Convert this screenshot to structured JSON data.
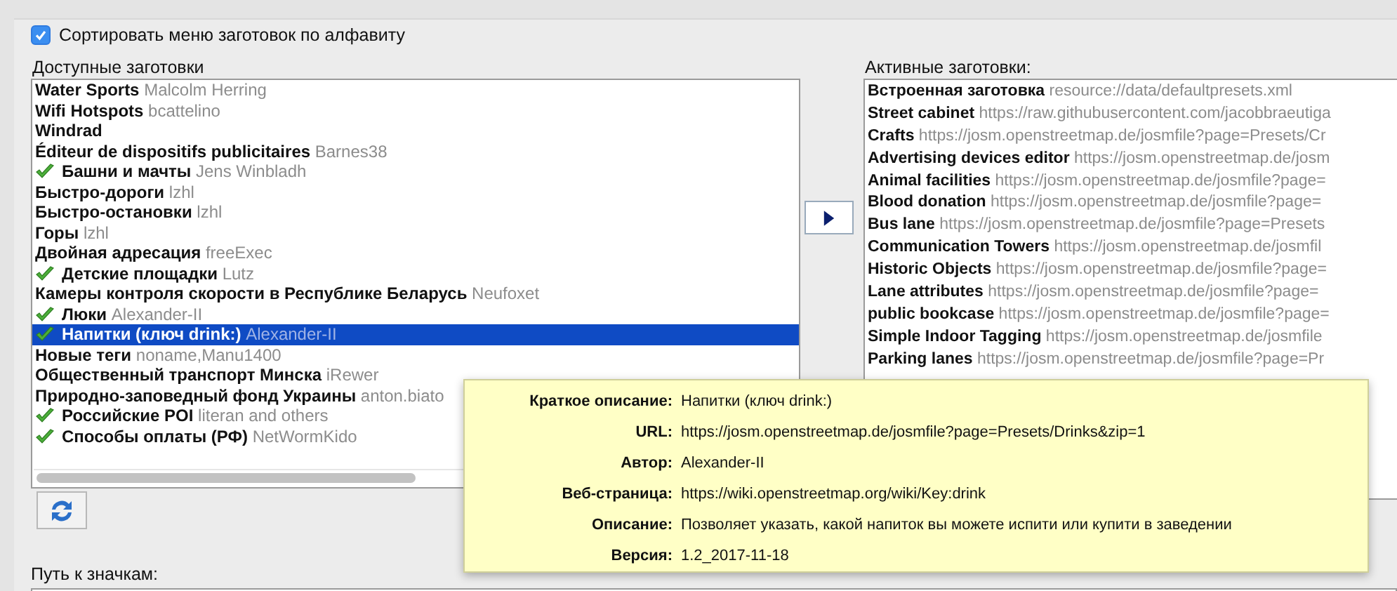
{
  "sort_alphabetically": {
    "label": "Сортировать меню заготовок по алфавиту",
    "checked": true
  },
  "available": {
    "label": "Доступные заготовки",
    "items": [
      {
        "name": "Water Sports",
        "author": "Malcolm Herring",
        "active": false,
        "selected": false
      },
      {
        "name": "Wifi Hotspots",
        "author": "bcattelino",
        "active": false,
        "selected": false
      },
      {
        "name": "Windrad",
        "active": false,
        "selected": false
      },
      {
        "name": "Éditeur de dispositifs publicitaires",
        "author": "Barnes38",
        "active": false,
        "selected": false
      },
      {
        "name": "Башни и мачты",
        "author": "Jens Winbladh",
        "active": true,
        "selected": false
      },
      {
        "name": "Быстро-дороги",
        "author": "lzhl",
        "active": false,
        "selected": false
      },
      {
        "name": "Быстро-остановки",
        "author": "lzhl",
        "active": false,
        "selected": false
      },
      {
        "name": "Горы",
        "author": "lzhl",
        "active": false,
        "selected": false
      },
      {
        "name": "Двойная адресация",
        "author": "freeExec",
        "active": false,
        "selected": false
      },
      {
        "name": "Детские площадки",
        "author": "Lutz",
        "active": true,
        "selected": false
      },
      {
        "name": "Камеры контроля скорости в Республике Беларусь",
        "author": "Neufoxet",
        "active": false,
        "selected": false
      },
      {
        "name": "Люки",
        "author": "Alexander-II",
        "active": true,
        "selected": false
      },
      {
        "name": "Напитки (ключ drink:)",
        "author": "Alexander-II",
        "active": true,
        "selected": true
      },
      {
        "name": "Новые теги",
        "author": "noname,Manu1400",
        "active": false,
        "selected": false
      },
      {
        "name": "Общественный транспорт Минска",
        "author": "iRewer",
        "active": false,
        "selected": false
      },
      {
        "name": "Природно-заповедный фонд Украины",
        "author": "anton.biato",
        "active": false,
        "selected": false
      },
      {
        "name": "Российские POI",
        "author": "literan and others",
        "active": true,
        "selected": false
      },
      {
        "name": "Способы оплаты (РФ)",
        "author": "NetWormKido",
        "active": true,
        "selected": false
      }
    ]
  },
  "active_presets": {
    "label": "Активные заготовки:",
    "items": [
      {
        "name": "Встроенная заготовка",
        "url": "resource://data/defaultpresets.xml"
      },
      {
        "name": "Street cabinet",
        "url": "https://raw.githubusercontent.com/jacobbraeutiga"
      },
      {
        "name": "Crafts",
        "url": "https://josm.openstreetmap.de/josmfile?page=Presets/Cr"
      },
      {
        "name": "Advertising devices editor",
        "url": "https://josm.openstreetmap.de/josm"
      },
      {
        "name": "Animal facilities",
        "url": "https://josm.openstreetmap.de/josmfile?page="
      },
      {
        "name": "Blood donation",
        "url": "https://josm.openstreetmap.de/josmfile?page="
      },
      {
        "name": "Bus lane",
        "url": "https://josm.openstreetmap.de/josmfile?page=Presets"
      },
      {
        "name": "Communication Towers",
        "url": "https://josm.openstreetmap.de/josmfil"
      },
      {
        "name": "Historic Objects",
        "url": "https://josm.openstreetmap.de/josmfile?page="
      },
      {
        "name": "Lane attributes",
        "url": "https://josm.openstreetmap.de/josmfile?page="
      },
      {
        "name": "public bookcase",
        "url": "https://josm.openstreetmap.de/josmfile?page="
      },
      {
        "name": "Simple Indoor Tagging",
        "url": "https://josm.openstreetmap.de/josmfile"
      },
      {
        "name": "Parking lanes",
        "url": "https://josm.openstreetmap.de/josmfile?page=Pr"
      }
    ]
  },
  "icon_path": {
    "label": "Путь к значкам:"
  },
  "tooltip": {
    "rows": [
      {
        "label": "Краткое описание:",
        "value": "Напитки (ключ drink:)"
      },
      {
        "label": "URL:",
        "value": "https://josm.openstreetmap.de/josmfile?page=Presets/Drinks&zip=1"
      },
      {
        "label": "Автор:",
        "value": "Alexander-II"
      },
      {
        "label": "Веб-страница:",
        "value": "https://wiki.openstreetmap.org/wiki/Key:drink"
      },
      {
        "label": "Описание:",
        "value": "Позволяет указать, какой напиток вы можете испити или купити в заведении"
      },
      {
        "label": "Версия:",
        "value": "1.2_2017-11-18"
      }
    ]
  }
}
